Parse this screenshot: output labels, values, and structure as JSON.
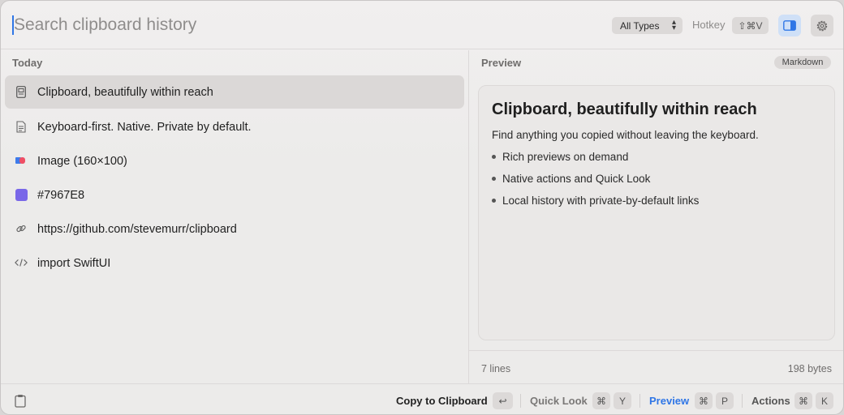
{
  "search": {
    "placeholder": "Search clipboard history"
  },
  "toolbar": {
    "type_filter": "All Types",
    "hotkey_label": "Hotkey",
    "hotkey_value": "⇧⌘V",
    "preview_toggle_icon": "sidebar-right-icon",
    "settings_icon": "gear-icon"
  },
  "history": {
    "section_title": "Today",
    "items": [
      {
        "label": "Clipboard, beautifully within reach",
        "icon": "document-rich-icon",
        "selected": true
      },
      {
        "label": "Keyboard-first. Native. Private by default.",
        "icon": "document-icon"
      },
      {
        "label": "Image (160×100)",
        "icon": "image-icon"
      },
      {
        "label": "#7967E8",
        "icon": "color-swatch-icon",
        "color": "#7967E8"
      },
      {
        "label": "https://github.com/stevemurr/clipboard",
        "icon": "link-icon"
      },
      {
        "label": "import SwiftUI",
        "icon": "code-icon"
      }
    ]
  },
  "preview": {
    "title": "Preview",
    "format": "Markdown",
    "heading": "Clipboard, beautifully within reach",
    "paragraph": "Find anything you copied without leaving the keyboard.",
    "bullets": [
      "Rich previews on demand",
      "Native actions and Quick Look",
      "Local history with private-by-default links"
    ],
    "lines": "7 lines",
    "bytes": "198 bytes"
  },
  "footer": {
    "copy_label": "Copy to Clipboard",
    "copy_key": "↩",
    "quicklook_label": "Quick Look",
    "quicklook_keys": [
      "⌘",
      "Y"
    ],
    "preview_label": "Preview",
    "preview_keys": [
      "⌘",
      "P"
    ],
    "actions_label": "Actions",
    "actions_keys": [
      "⌘",
      "K"
    ]
  },
  "colors": {
    "accent": "#2f76e6",
    "swatch": "#7967E8"
  }
}
